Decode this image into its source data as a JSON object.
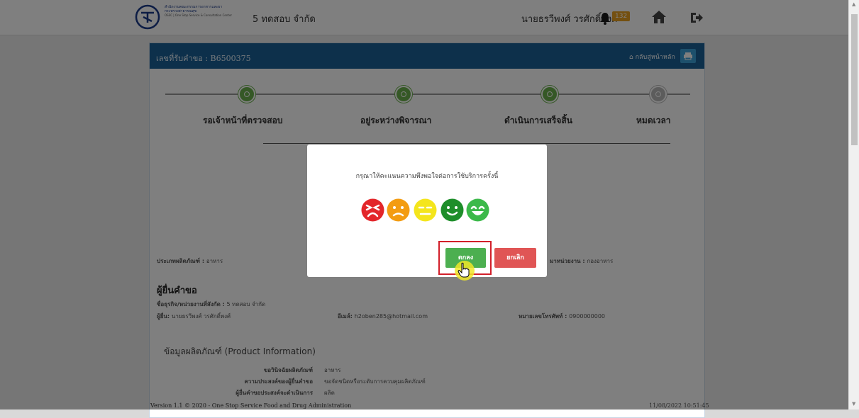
{
  "header": {
    "logo_org_line1": "สำนักงานคณะกรรมการอาหารและยา",
    "logo_org_line2": "กระทรวงสาธารณสุข",
    "logo_org_line3": "OSSC | One Stop Service & Consultation Center",
    "company": "5 ทดสอบ จำกัด",
    "username": "นายธรวีพงศ์ วรศักดิ์พงศ์",
    "notification_count": "132",
    "notification_badge_color": "#e8a020"
  },
  "panel": {
    "request_number": "เลขที่รับคำขอ : B6500375",
    "back_label": "กลับสู่หน้าหลัก",
    "header_color": "#1a6196"
  },
  "steps": [
    {
      "label": "รอเจ้าหน้าที่ตรวจสอบ",
      "status": "done"
    },
    {
      "label": "อยู่ระหว่างพิจารณา",
      "status": "done"
    },
    {
      "label": "ดำเนินการเสร็จสิ้น",
      "status": "done"
    },
    {
      "label": "หมดเวลา",
      "status": "pending"
    }
  ],
  "info": {
    "product_type_label": "ประเภทผลิตภัณฑ์ :",
    "product_type_value": "อาหาร",
    "agency_label": "มาหน่วยงาน :",
    "agency_value": "กองอาหาร",
    "applicant_section": "ผู้ยื่นคำขอ",
    "business_label": "ชื่อธุรกิจ/หน่วยงานที่สังกัด :",
    "business_value": "5 ทดสอบ จำกัด",
    "applicant_label": "ผู้ยื่น:",
    "applicant_value": "นายธรวีพงศ์ วรศักดิ์พงศ์",
    "email_label": "อีเมล์:",
    "email_value": "h2oben285@hotmail.com",
    "phone_label": "หมายเลขโทรศัพท์ :",
    "phone_value": "0900000000",
    "product_section": "ข้อมูลผลิตภัณฑ์ (Product Information)",
    "kv": [
      {
        "key": "ขอวินิจฉัยผลิตภัณฑ์",
        "value": "อาหาร"
      },
      {
        "key": "ความประสงค์ของผู้ยื่นคำขอ",
        "value": "ขอจัดชนิดหรือระดับการควบคุมผลิตภัณฑ์"
      },
      {
        "key": "ผู้ยื่นคำขอประสงค์จะดำเนินการ",
        "value": "ผลิต"
      }
    ]
  },
  "footer": {
    "version": "Version 1.1 © 2020 - One Stop Service Food and Drug Administration",
    "timestamp": "11/08/2022 10:51:45"
  },
  "modal": {
    "prompt": "กรุณาให้คะแนนความพึงพอใจต่อการใช้บริการครั้งนี้",
    "ok_label": "ตกลง",
    "cancel_label": "ยกเลิก",
    "emojis": [
      {
        "name": "very-dissatisfied",
        "color": "#e3262a"
      },
      {
        "name": "dissatisfied",
        "color": "#f39c12"
      },
      {
        "name": "neutral",
        "color": "#f4e51c"
      },
      {
        "name": "satisfied",
        "color": "#1e8e2a"
      },
      {
        "name": "very-satisfied",
        "color": "#3cb94a"
      }
    ]
  }
}
